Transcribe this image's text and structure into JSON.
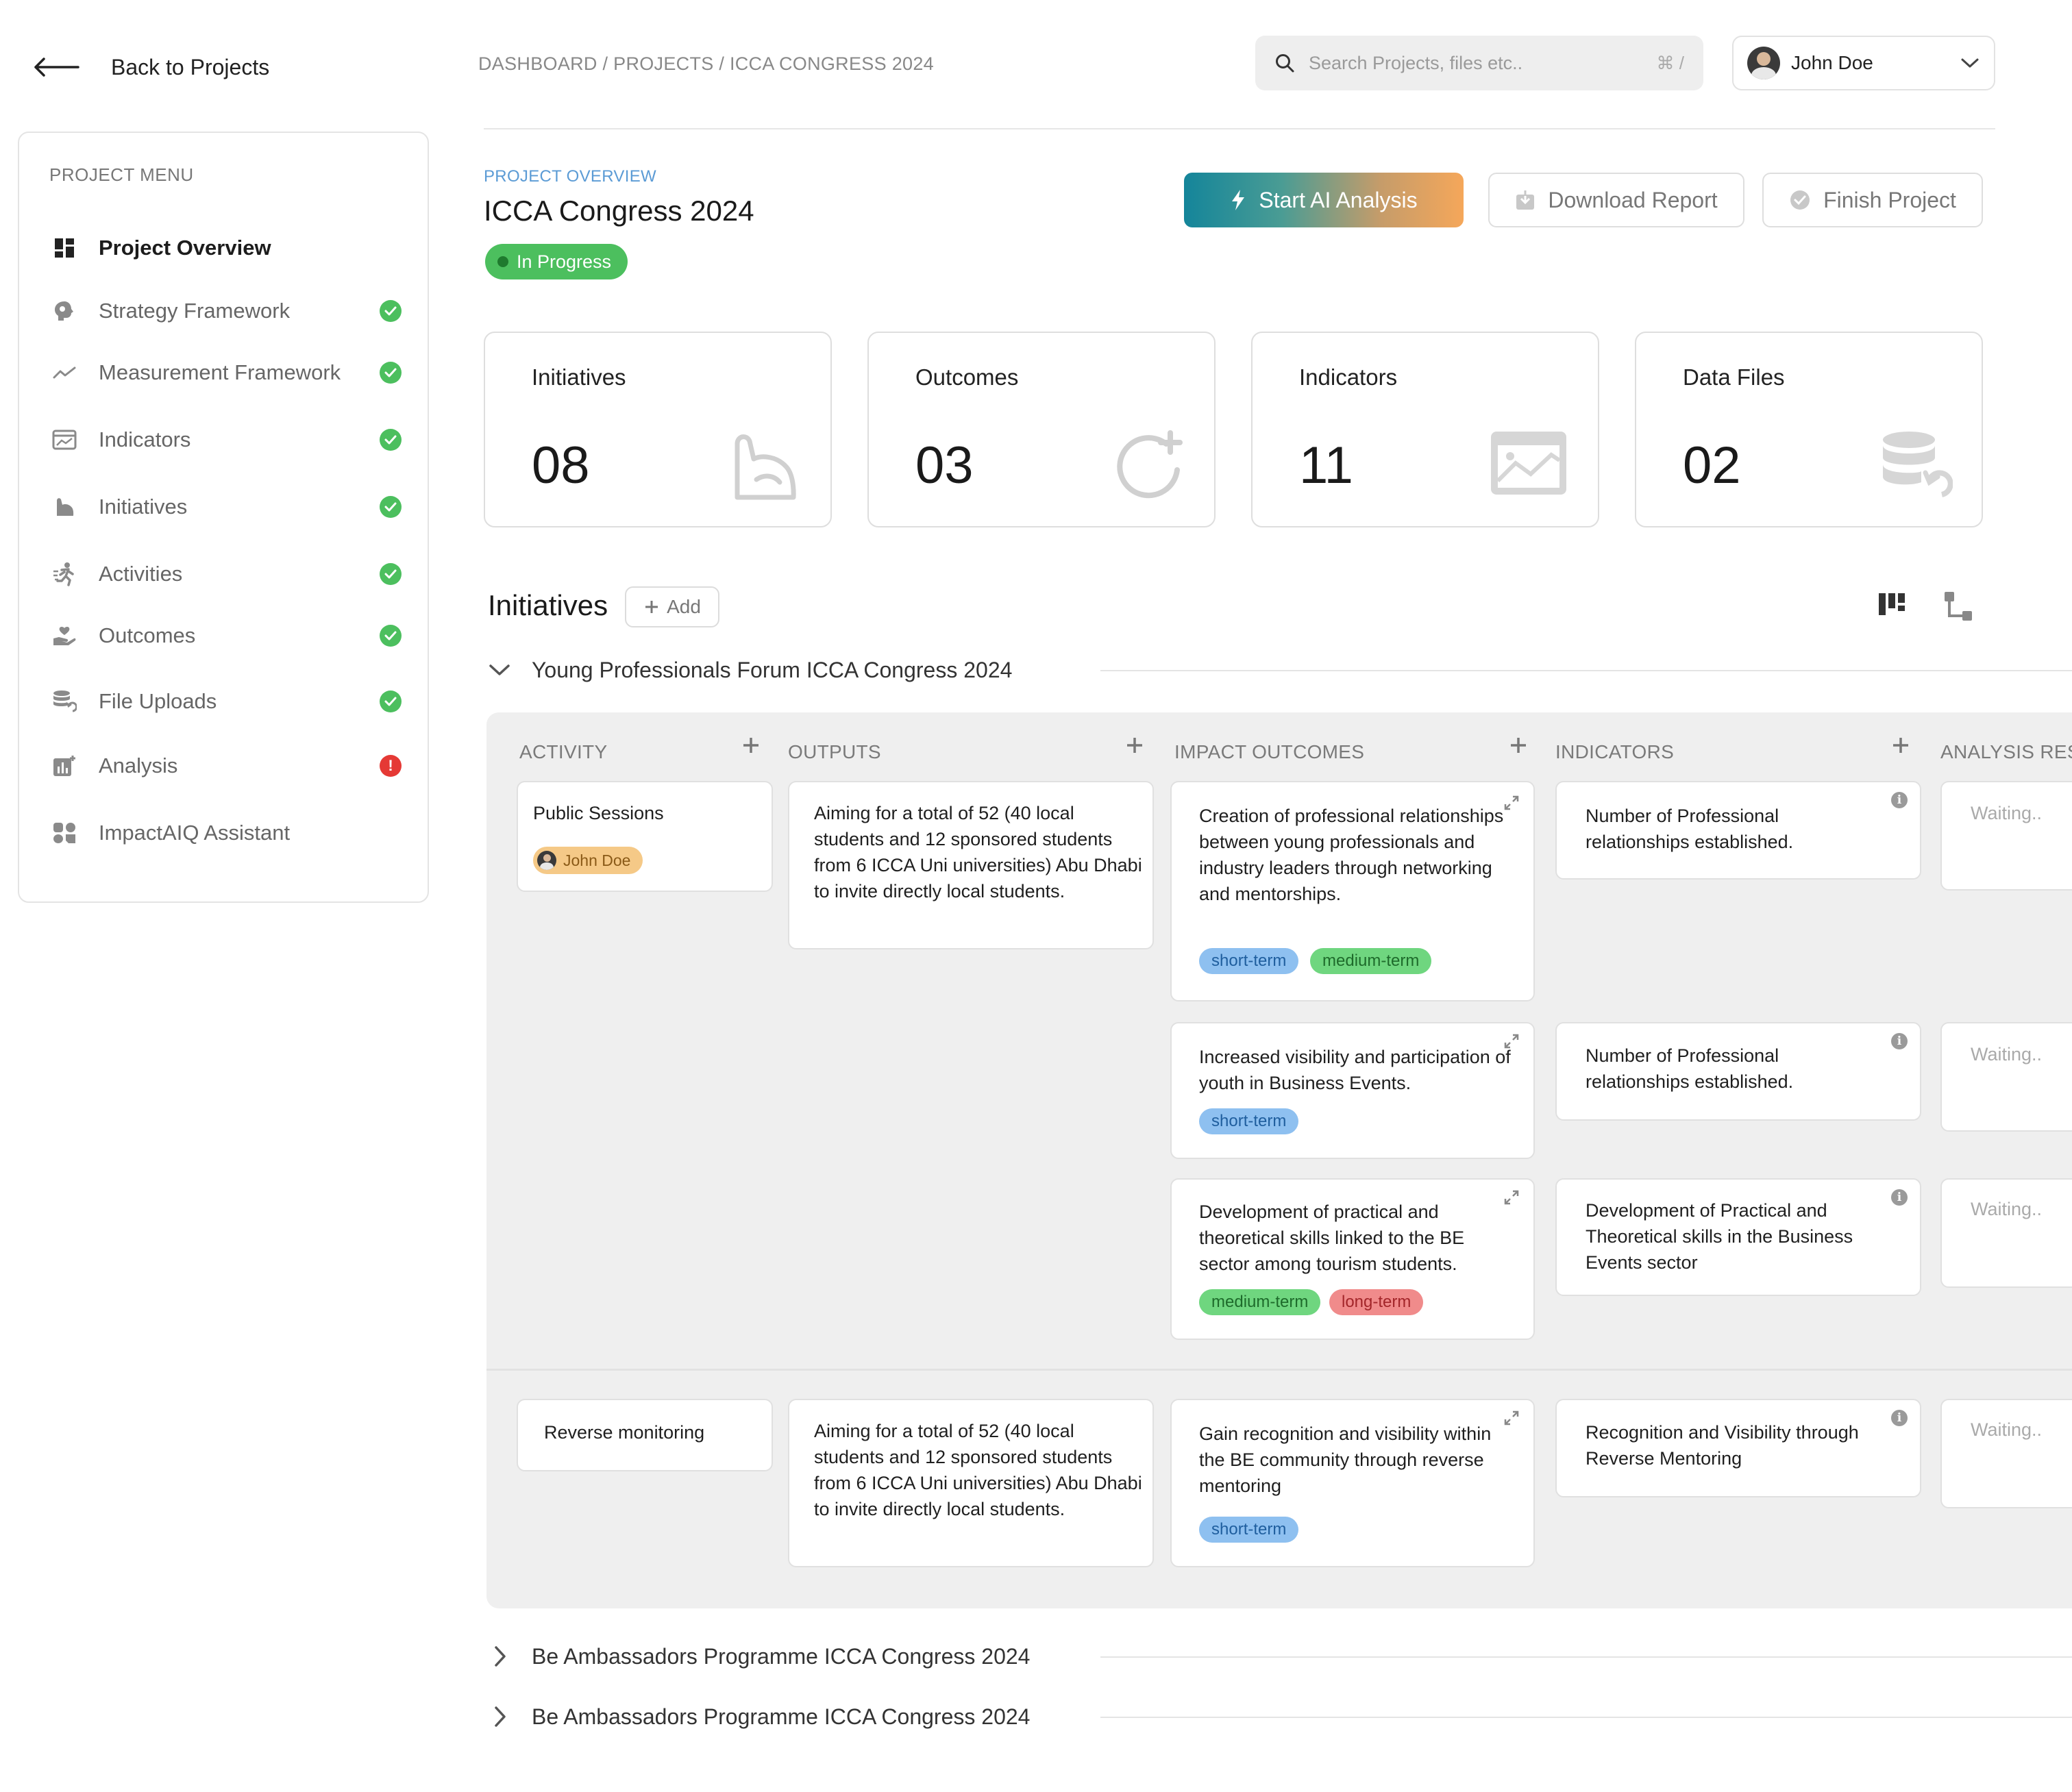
{
  "nav": {
    "back_label": "Back to Projects"
  },
  "breadcrumb": "DASHBOARD / PROJECTS / ICCA CONGRESS 2024",
  "search": {
    "placeholder": "Search Projects, files etc..",
    "shortcut": "⌘ /"
  },
  "user": {
    "name": "John Doe"
  },
  "sidebar": {
    "title": "PROJECT MENU",
    "items": [
      {
        "label": "Project Overview",
        "icon": "dashboard-icon",
        "status": "active"
      },
      {
        "label": "Strategy Framework",
        "icon": "brain-icon",
        "status": "done"
      },
      {
        "label": "Measurement Framework",
        "icon": "trend-icon",
        "status": "done"
      },
      {
        "label": "Indicators",
        "icon": "chart-window-icon",
        "status": "done"
      },
      {
        "label": "Initiatives",
        "icon": "flex-arm-icon",
        "status": "done"
      },
      {
        "label": "Activities",
        "icon": "running-icon",
        "status": "done"
      },
      {
        "label": "Outcomes",
        "icon": "hand-heart-icon",
        "status": "done"
      },
      {
        "label": "File Uploads",
        "icon": "database-sync-icon",
        "status": "done"
      },
      {
        "label": "Analysis",
        "icon": "analysis-icon",
        "status": "warning"
      },
      {
        "label": "ImpactAIQ Assistant",
        "icon": "assistant-icon",
        "status": "none"
      }
    ]
  },
  "header": {
    "overline": "PROJECT OVERVIEW",
    "title": "ICCA Congress 2024",
    "status": "In Progress",
    "actions": {
      "ai": "Start AI Analysis",
      "download": "Download Report",
      "finish": "Finish Project"
    }
  },
  "stats": [
    {
      "label": "Initiatives",
      "value": "08",
      "icon": "flex-arm-icon"
    },
    {
      "label": "Outcomes",
      "value": "03",
      "icon": "refresh-circle-icon"
    },
    {
      "label": "Indicators",
      "value": "11",
      "icon": "chart-window-icon"
    },
    {
      "label": "Data Files",
      "value": "02",
      "icon": "database-sync-icon"
    }
  ],
  "initiatives": {
    "title": "Initiatives",
    "add_label": "Add",
    "columns": [
      "ACTIVITY",
      "OUTPUTS",
      "IMPACT OUTCOMES",
      "INDICATORS",
      "ANALYSIS RESULTS"
    ],
    "groups": [
      {
        "name": "Young Professionals Forum ICCA Congress 2024",
        "expanded": true,
        "rows": [
          {
            "activity": "Public Sessions",
            "owner": "John Doe",
            "output": "Aiming for a total of 52 (40 local students and 12 sponsored students from 6 ICCA Uni universities) Abu Dhabi to invite directly local students.",
            "outcomes": [
              {
                "text": "Creation of professional relationships between young professionals and industry leaders through networking and mentorships.",
                "tags": [
                  "short-term",
                  "medium-term"
                ],
                "indicator": "Number of Professional relationships established.",
                "analysis": "Waiting.."
              },
              {
                "text": "Increased visibility and participation of youth in Business Events.",
                "tags": [
                  "short-term"
                ],
                "indicator": "Number of Professional relationships established.",
                "analysis": "Waiting.."
              },
              {
                "text": "Development of practical and theoretical skills linked to the BE sector among tourism students.",
                "tags": [
                  "medium-term",
                  "long-term"
                ],
                "indicator": "Development of Practical and Theoretical skills in the Business Events sector",
                "analysis": "Waiting.."
              }
            ]
          },
          {
            "activity": "Reverse monitoring",
            "output": "Aiming for a total of 52 (40 local students and 12 sponsored students from 6 ICCA Uni universities) Abu Dhabi to invite directly local students.",
            "outcomes": [
              {
                "text": "Gain recognition and visibility within the BE community through reverse mentoring",
                "tags": [
                  "short-term"
                ],
                "indicator": "Recognition and Visibility through Reverse Mentoring",
                "analysis": "Waiting.."
              }
            ]
          }
        ]
      },
      {
        "name": "Be Ambassadors Programme ICCA Congress 2024",
        "expanded": false
      },
      {
        "name": "Be Ambassadors Programme ICCA Congress 2024",
        "expanded": false
      }
    ]
  },
  "colors": {
    "accent_green": "#4cbf5e",
    "warning_red": "#e53935",
    "ai_gradient_start": "#14859a",
    "ai_gradient_end": "#f5a75a",
    "overline_blue": "#5b9bd5",
    "tag_short": "#8ec0f0",
    "tag_medium": "#6fd67f",
    "tag_long": "#f08b8b"
  }
}
